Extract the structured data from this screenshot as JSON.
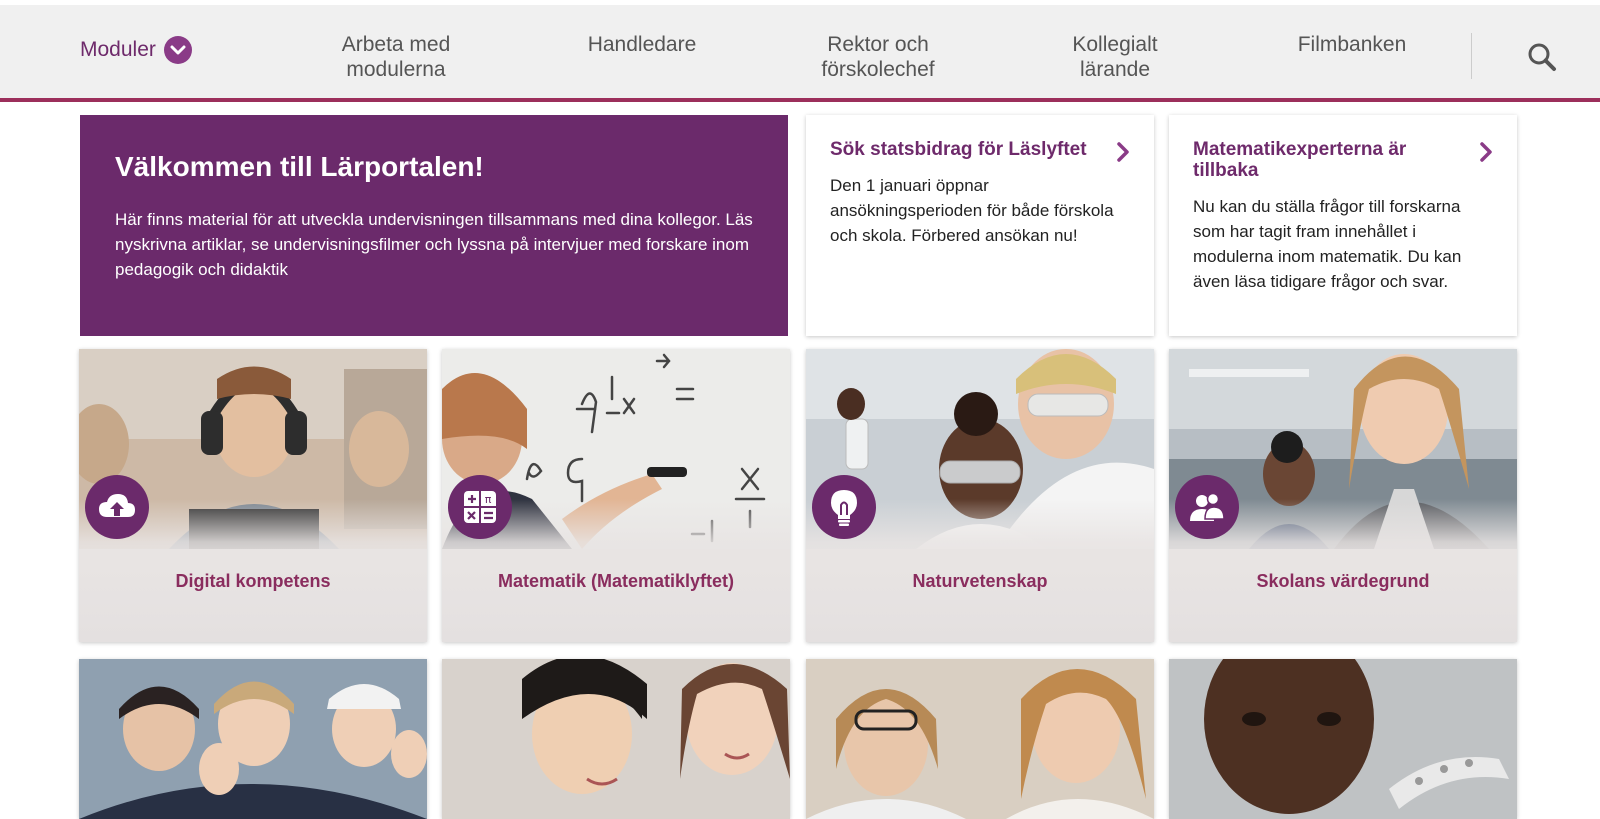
{
  "nav": {
    "modules_label": "Moduler",
    "items": [
      {
        "label": "Arbeta med\nmodulerna"
      },
      {
        "label": "Handledare"
      },
      {
        "label": "Rektor och\nförskolechef"
      },
      {
        "label": "Kollegialt\nlärande"
      },
      {
        "label": "Filmbanken"
      }
    ],
    "search_icon": "search-icon"
  },
  "hero": {
    "title": "Välkommen till Lärportalen!",
    "text": "Här finns material för att utveckla undervisningen tillsammans med dina kollegor. Läs nyskrivna artiklar, se undervisningsfilmer och lyssna på intervjuer med forskare inom pedagogik och didaktik"
  },
  "cards": [
    {
      "title": "Sök statsbidrag för Läslyftet",
      "text": "Den 1 januari öppnar ansökningsperioden för både förskola och skola. Förbered ansökan nu!"
    },
    {
      "title": "Matematikexperterna är tillbaka",
      "text": "Nu kan du ställa frågor till forskarna som har tagit fram innehållet i modulerna inom matematik. Du kan även läsa tidigare frågor och svar."
    }
  ],
  "tiles": [
    {
      "label": "Digital kompetens",
      "icon": "cloud-upload-icon"
    },
    {
      "label": "Matematik (Matematiklyftet)",
      "icon": "calculator-icon"
    },
    {
      "label": "Naturvetenskap",
      "icon": "lightbulb-icon"
    },
    {
      "label": "Skolans värdegrund",
      "icon": "people-icon"
    }
  ],
  "colors": {
    "brand_purple": "#6b2a6b",
    "accent_line": "#9c2f5b",
    "nav_background": "#f0f0f0",
    "tile_label": "#8a2d5e"
  }
}
